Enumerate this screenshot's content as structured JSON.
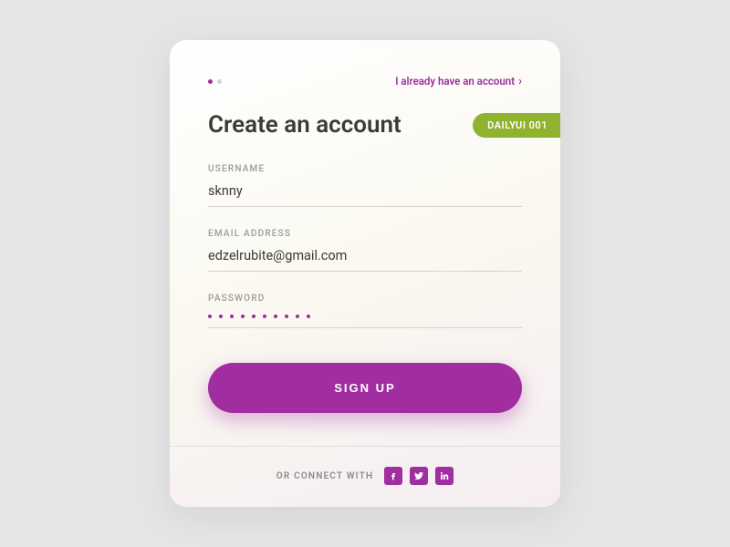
{
  "header": {
    "login_link": "I already have an account"
  },
  "title": "Create an account",
  "badge": "DAILYUI 001",
  "fields": {
    "username": {
      "label": "USERNAME",
      "value": "sknny"
    },
    "email": {
      "label": "EMAIL ADDRESS",
      "value": "edzelrubite@gmail.com"
    },
    "password": {
      "label": "PASSWORD",
      "dot_count": 10
    }
  },
  "actions": {
    "signup": "SIGN UP"
  },
  "social": {
    "label": "OR CONNECT WITH"
  },
  "colors": {
    "accent": "#a12ea0",
    "badge": "#8fb32e"
  }
}
